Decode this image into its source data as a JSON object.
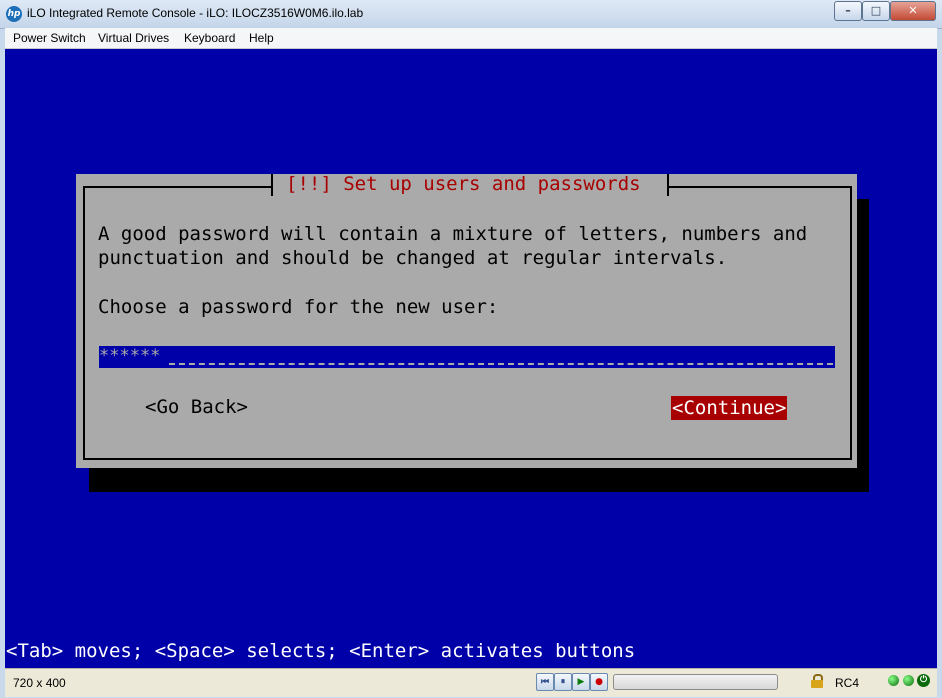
{
  "window": {
    "title": "iLO Integrated Remote Console - iLO: ILOCZ3516W0M6.ilo.lab",
    "logo_text": "hp",
    "controls": {
      "minimize": "–",
      "maximize": "□",
      "close": "✕"
    }
  },
  "menu": [
    "Power Switch",
    "Virtual Drives",
    "Keyboard",
    "Help"
  ],
  "dialog": {
    "title": "[!!] Set up users and passwords",
    "text_line1": "A good password will contain a mixture of letters, numbers and",
    "text_line2": "punctuation and should be changed at regular intervals.",
    "prompt": "Choose a password for the new user:",
    "password_value": "******",
    "go_back": "<Go Back>",
    "continue": "<Continue>"
  },
  "help_line": "<Tab> moves; <Space> selects; <Enter> activates buttons",
  "status": {
    "resolution": "720 x 400",
    "encryption": "RC4",
    "playback_buttons": [
      "⏮",
      "⏸",
      "▶",
      "●"
    ]
  },
  "colors": {
    "console_bg": "#0000a8",
    "dialog_bg": "#aaaaaa",
    "title_red": "#a80000",
    "button_selected": "#a80000"
  }
}
